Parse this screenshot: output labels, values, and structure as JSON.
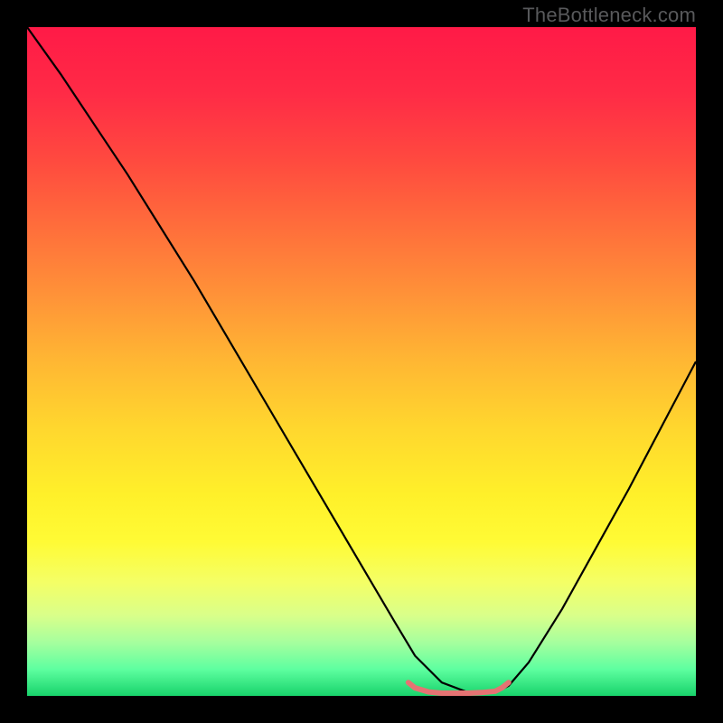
{
  "attribution": "TheBottleneck.com",
  "chart_data": {
    "type": "line",
    "title": "",
    "xlabel": "",
    "ylabel": "",
    "xlim": [
      0,
      100
    ],
    "ylim": [
      0,
      100
    ],
    "background_gradient": {
      "stops": [
        {
          "offset": 0.0,
          "color": "#ff1a47"
        },
        {
          "offset": 0.1,
          "color": "#ff2b46"
        },
        {
          "offset": 0.2,
          "color": "#ff4a3f"
        },
        {
          "offset": 0.3,
          "color": "#ff6e3b"
        },
        {
          "offset": 0.4,
          "color": "#ff9238"
        },
        {
          "offset": 0.5,
          "color": "#ffb733"
        },
        {
          "offset": 0.6,
          "color": "#ffd72e"
        },
        {
          "offset": 0.7,
          "color": "#fff02a"
        },
        {
          "offset": 0.77,
          "color": "#fffb35"
        },
        {
          "offset": 0.83,
          "color": "#f4ff66"
        },
        {
          "offset": 0.88,
          "color": "#d9ff8a"
        },
        {
          "offset": 0.92,
          "color": "#a6ff9e"
        },
        {
          "offset": 0.96,
          "color": "#5effa0"
        },
        {
          "offset": 1.0,
          "color": "#18d36b"
        }
      ]
    },
    "series": [
      {
        "name": "bottleneck-curve",
        "color": "#000000",
        "width": 2.2,
        "x": [
          0,
          5,
          10,
          15,
          20,
          25,
          30,
          35,
          40,
          45,
          50,
          55,
          58,
          62,
          66,
          70,
          72,
          75,
          80,
          85,
          90,
          95,
          100
        ],
        "y": [
          100,
          93,
          85.5,
          78,
          70,
          62,
          53.5,
          45,
          36.5,
          28,
          19.5,
          11,
          6,
          2,
          0.5,
          0.5,
          1.5,
          5,
          13,
          22,
          31,
          40.5,
          50
        ]
      },
      {
        "name": "optimal-marker",
        "color": "#e57373",
        "width": 6,
        "x": [
          57,
          58,
          60,
          62,
          64,
          66,
          68,
          70,
          71,
          72
        ],
        "y": [
          2.0,
          1.2,
          0.6,
          0.4,
          0.4,
          0.4,
          0.5,
          0.7,
          1.2,
          2.0
        ]
      }
    ]
  }
}
